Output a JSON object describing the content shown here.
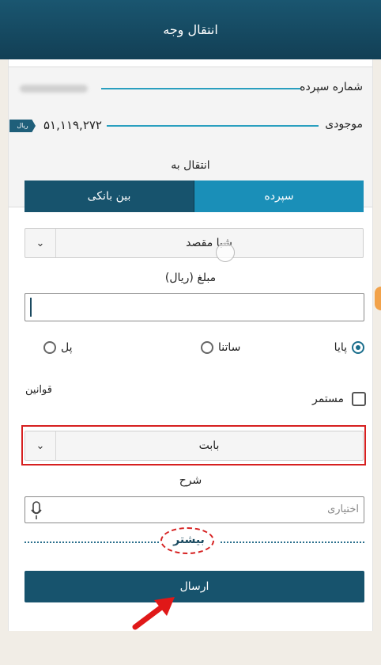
{
  "header": {
    "title": "انتقال وجه"
  },
  "account": {
    "number_label": "شماره سپرده",
    "balance_label": "موجودی",
    "balance_value": "۵۱,۱۱۹,۲۷۲",
    "currency": "ریال"
  },
  "transfer_to": {
    "label": "انتقال به",
    "options": [
      "سپرده",
      "بین بانکی"
    ],
    "selected": "سپرده"
  },
  "destination": {
    "value": "شبا مقصد"
  },
  "amount": {
    "label": "مبلغ (ریال)",
    "value": ""
  },
  "methods": {
    "options": [
      "پایا",
      "ساتنا",
      "پل"
    ],
    "selected": "پایا"
  },
  "recurring": {
    "label": "مستمر",
    "checked": false
  },
  "rules": {
    "label": "قوانین"
  },
  "reason": {
    "value": "بابت"
  },
  "description": {
    "label": "شرح",
    "placeholder": "اختیاری"
  },
  "more": {
    "label": "بیشتر"
  },
  "submit": {
    "label": "ارسال"
  },
  "colors": {
    "header": "#164a62",
    "primary": "#17536d",
    "accent": "#1a8fb8",
    "highlight": "#d62020"
  }
}
